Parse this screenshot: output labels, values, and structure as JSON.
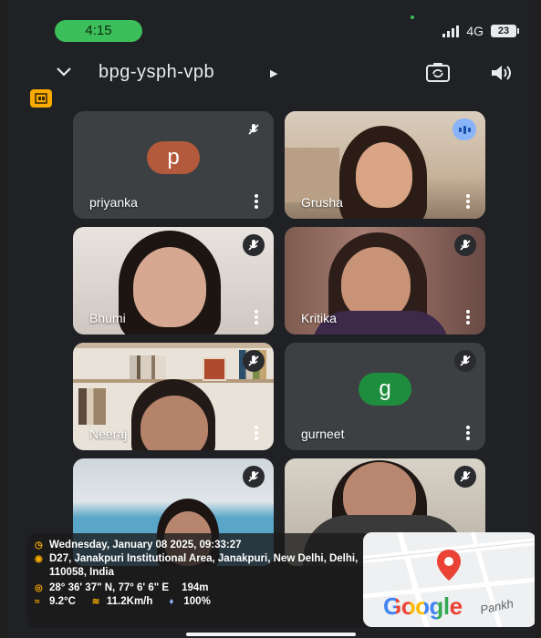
{
  "status_bar": {
    "time": "4:15",
    "network": "4G",
    "battery": "23"
  },
  "meeting": {
    "code": "bpg-ysph-vpb"
  },
  "participants": [
    {
      "name": "priyanka",
      "avatar_letter": "p",
      "avatar_color": "#b35a3c",
      "mic": "muted",
      "video": false
    },
    {
      "name": "Grusha",
      "mic": "speaking",
      "video": true
    },
    {
      "name": "Bhumi",
      "mic": "muted",
      "video": true
    },
    {
      "name": "Kritika",
      "mic": "muted",
      "video": true
    },
    {
      "name": "Neeraj",
      "mic": "muted",
      "video": true
    },
    {
      "name": "gurneet",
      "avatar_letter": "g",
      "avatar_color": "#1e8e3e",
      "mic": "muted",
      "video": false
    },
    {
      "name": "",
      "mic": "muted",
      "video": true
    },
    {
      "name": "",
      "mic": "muted",
      "video": true
    }
  ],
  "gps_overlay": {
    "datetime": "Wednesday, January 08 2025, 09:33:27",
    "address": "D27, Janakpuri Institutional Area, Janakpuri, New Delhi, Delhi, 110058, India",
    "coordinates": "28° 36' 37\" N, 77° 6' 6\" E",
    "altitude": "194m",
    "temperature": "9.2°C",
    "wind": "11.2Km/h",
    "humidity": "100%"
  },
  "map": {
    "logo_text": "Google",
    "place_label": "Pankh"
  }
}
